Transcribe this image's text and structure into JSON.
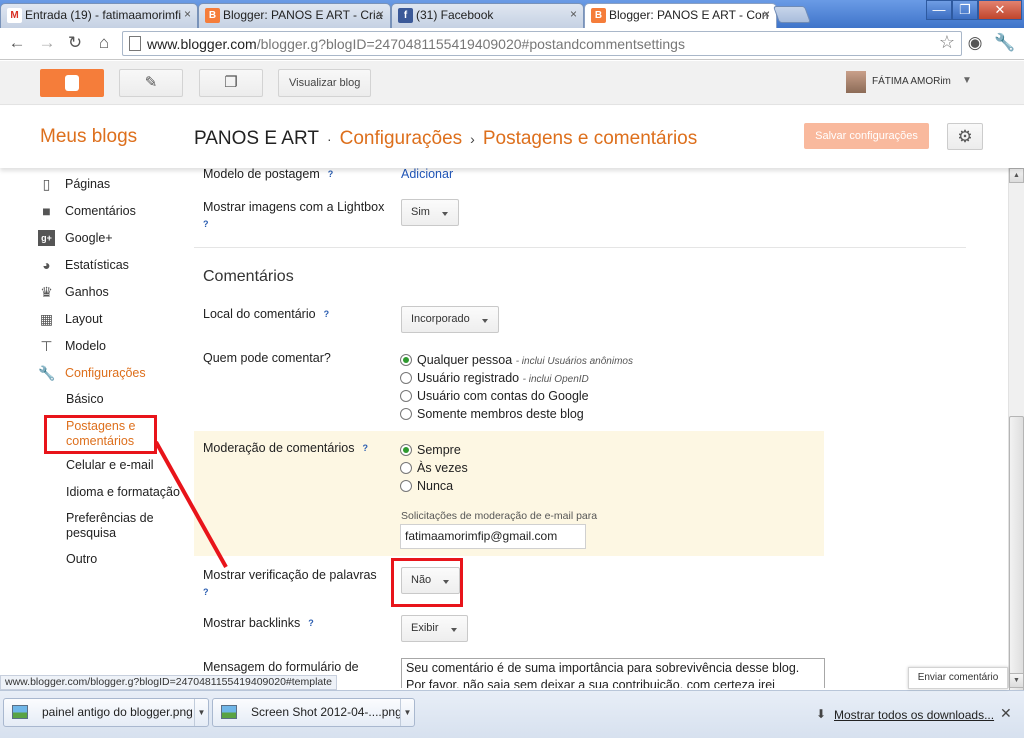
{
  "browser": {
    "tabs": [
      {
        "label": "Entrada (19) - fatimaamorimfi",
        "icon": "gmail-icon",
        "icon_text": "M",
        "icon_color": "#d93025"
      },
      {
        "label": "Blogger: PANOS E ART - Criar",
        "icon": "blogger-icon",
        "icon_text": "B",
        "icon_color": "#f57d3a"
      },
      {
        "label": "(31) Facebook",
        "icon": "facebook-icon",
        "icon_text": "f",
        "icon_color": "#3b5998"
      },
      {
        "label": "Blogger: PANOS E ART - Conf",
        "icon": "blogger-icon",
        "icon_text": "B",
        "icon_color": "#f57d3a"
      }
    ],
    "tab_close": "×",
    "window_controls": {
      "minimize": "—",
      "restore": "❐",
      "close": "✕"
    },
    "address_host": "www.blogger.com",
    "address_path": "/blogger.g?blogID=2470481155419409020#postandcommentsettings"
  },
  "header": {
    "view_blog": "Visualizar blog",
    "user_name": "FÁTIMA AMORim"
  },
  "page": {
    "my_blogs": "Meus blogs",
    "blog_name": "PANOS E ART",
    "dot_sep": "·",
    "crumb_settings": "Configurações",
    "arrow_sep": "›",
    "crumb_current": "Postagens e comentários",
    "save_button": "Salvar configurações"
  },
  "sidebar": {
    "items": [
      {
        "label": "Páginas",
        "icon": "pages-icon"
      },
      {
        "label": "Comentários",
        "icon": "comment-icon"
      },
      {
        "label": "Google+",
        "icon": "google-plus-icon"
      },
      {
        "label": "Estatísticas",
        "icon": "stats-icon"
      },
      {
        "label": "Ganhos",
        "icon": "trophy-icon"
      },
      {
        "label": "Layout",
        "icon": "layout-icon"
      },
      {
        "label": "Modelo",
        "icon": "template-icon"
      },
      {
        "label": "Configurações",
        "icon": "wrench-icon"
      }
    ],
    "sub_items": [
      "Básico",
      "Postagens e comentários",
      "Celular e e-mail",
      "Idioma e formatação",
      "Preferências de pesquisa",
      "Outro"
    ]
  },
  "settings": {
    "help": "?",
    "post_template_label": "Modelo de postagem",
    "post_template_action": "Adicionar",
    "lightbox_label": "Mostrar imagens com a Lightbox",
    "lightbox_value": "Sim",
    "comments_title": "Comentários",
    "comment_location_label": "Local do comentário",
    "comment_location_value": "Incorporado",
    "who_can_comment_label": "Quem pode comentar?",
    "who_can_comment_options": [
      {
        "label": "Qualquer pessoa",
        "note": "- inclui Usuários anônimos",
        "checked": true
      },
      {
        "label": "Usuário registrado",
        "note": "- inclui OpenID",
        "checked": false
      },
      {
        "label": "Usuário com contas do Google",
        "note": "",
        "checked": false
      },
      {
        "label": "Somente membros deste blog",
        "note": "",
        "checked": false
      }
    ],
    "moderation_label": "Moderação de comentários",
    "moderation_options": [
      {
        "label": "Sempre",
        "checked": true
      },
      {
        "label": "Às vezes",
        "checked": false
      },
      {
        "label": "Nunca",
        "checked": false
      }
    ],
    "moderation_email_label": "Solicitações de moderação de e-mail para",
    "moderation_email_value": "fatimaamorimfip@gmail.com",
    "word_verification_label": "Mostrar verificação de palavras",
    "word_verification_value": "Não",
    "backlinks_label": "Mostrar backlinks",
    "backlinks_value": "Exibir",
    "form_message_label": "Mensagem do formulário de",
    "form_message_value": "Seu comentário é de suma importância para sobrevivência desse blog. Por favor, não saia sem deixar a sua contribuição, com certeza irei"
  },
  "status_url": "www.blogger.com/blogger.g?blogID=2470481155419409020#template",
  "feedback_button": "Enviar comentário",
  "downloads": {
    "items": [
      "painel antigo do blogger.png",
      "Screen Shot 2012-04-....png"
    ],
    "show_all": "Mostrar todos os downloads...",
    "close": "✕"
  },
  "colors": {
    "accent": "#dd6f1c",
    "annotation_red": "#e8141a",
    "moderation_bg": "#fdf7e3"
  }
}
